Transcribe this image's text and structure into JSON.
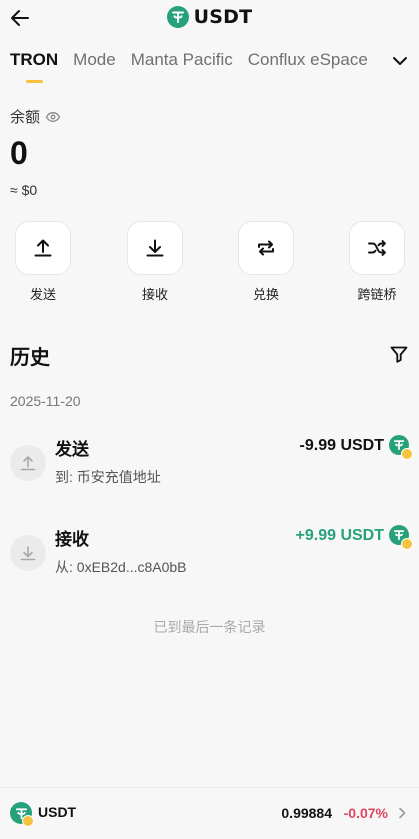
{
  "header": {
    "title": "USDT"
  },
  "tabs": [
    "TRON",
    "Mode",
    "Manta Pacific",
    "Conflux eSpace"
  ],
  "balance": {
    "label": "余额",
    "amount": "0",
    "fiat": "≈ $0"
  },
  "actions": [
    {
      "label": "发送",
      "icon": "upload-arrow-icon"
    },
    {
      "label": "接收",
      "icon": "download-arrow-icon"
    },
    {
      "label": "兑换",
      "icon": "swap-icon"
    },
    {
      "label": "跨链桥",
      "icon": "shuffle-icon"
    }
  ],
  "history": {
    "title": "历史",
    "date": "2025-11-20",
    "transactions": [
      {
        "type": "发送",
        "sub": "到: 币安充值地址",
        "amount": "-9.99 USDT"
      },
      {
        "type": "接收",
        "sub": "从: 0xEB2d...c8A0bB",
        "amount": "+9.99 USDT"
      }
    ],
    "end_note": "已到最后一条记录"
  },
  "bottom": {
    "name": "USDT",
    "price": "0.99884",
    "change": "-0.07%"
  },
  "colors": {
    "accent": "#f6c340",
    "tether": "#26a17b",
    "positive": "#26a17b",
    "negative": "#e0465e"
  }
}
